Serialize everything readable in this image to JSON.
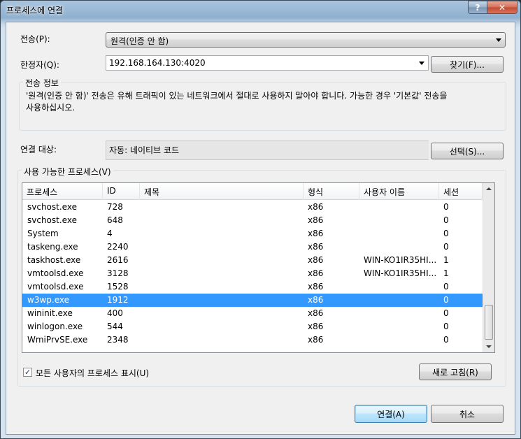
{
  "window": {
    "title": "프로세스에 연결",
    "help_glyph": "?",
    "close_glyph": "✕"
  },
  "transport": {
    "label": "전송(P):",
    "value": "원격(인증 안 함)"
  },
  "qualifier": {
    "label": "한정자(Q):",
    "value": "192.168.164.130:4020",
    "find_button": "찾기(F)..."
  },
  "transport_info": {
    "title": "전송 정보",
    "text_line1": "'원격(인증 안 함)' 전송은 유해 트래픽이 있는 네트워크에서 절대로 사용하지 말아야 합니다. 가능한 경우 '기본값' 전송을",
    "text_line2": "사용하십시오."
  },
  "attach_to": {
    "label": "연결 대상:",
    "value": "자동: 네이티브 코드",
    "select_button": "선택(S)..."
  },
  "processes": {
    "group_title": "사용 가능한 프로세스(V)",
    "columns": [
      "프로세스",
      "ID",
      "제목",
      "형식",
      "사용자 이름",
      "세션"
    ],
    "rows": [
      {
        "process": "svchost.exe",
        "id": "728",
        "title": "",
        "type": "x86",
        "user": "",
        "session": "0"
      },
      {
        "process": "svchost.exe",
        "id": "648",
        "title": "",
        "type": "x86",
        "user": "",
        "session": "0"
      },
      {
        "process": "System",
        "id": "4",
        "title": "",
        "type": "x86",
        "user": "",
        "session": "0"
      },
      {
        "process": "taskeng.exe",
        "id": "2240",
        "title": "",
        "type": "x86",
        "user": "",
        "session": "0"
      },
      {
        "process": "taskhost.exe",
        "id": "2616",
        "title": "",
        "type": "x86",
        "user": "WIN-KO1IR35HI...",
        "session": "1"
      },
      {
        "process": "vmtoolsd.exe",
        "id": "3128",
        "title": "",
        "type": "x86",
        "user": "WIN-KO1IR35HI...",
        "session": "1"
      },
      {
        "process": "vmtoolsd.exe",
        "id": "1528",
        "title": "",
        "type": "x86",
        "user": "",
        "session": "0"
      },
      {
        "process": "w3wp.exe",
        "id": "1912",
        "title": "",
        "type": "x86",
        "user": "",
        "session": "0",
        "selected": true
      },
      {
        "process": "wininit.exe",
        "id": "400",
        "title": "",
        "type": "x86",
        "user": "",
        "session": "0"
      },
      {
        "process": "winlogon.exe",
        "id": "544",
        "title": "",
        "type": "x86",
        "user": "",
        "session": "0"
      },
      {
        "process": "WmiPrvSE.exe",
        "id": "2348",
        "title": "",
        "type": "x86",
        "user": "",
        "session": "0"
      }
    ],
    "show_all_users_label": "모든 사용자의 프로세스 표시(U)",
    "show_all_users_checked": true,
    "refresh_button": "새로 고침(R)"
  },
  "footer": {
    "attach_button": "연결(A)",
    "cancel_button": "취소"
  },
  "colors": {
    "selection": "#3399ff"
  }
}
